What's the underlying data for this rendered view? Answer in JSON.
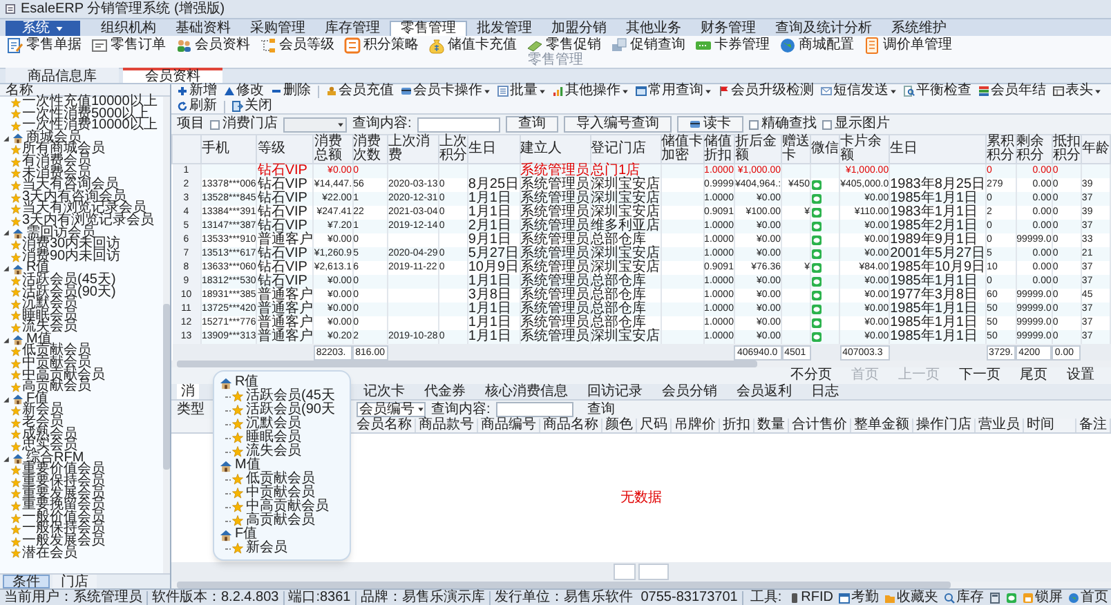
{
  "window": {
    "title": "EsaleERP 分销管理系统 (增强版)"
  },
  "menu": [
    {
      "label": "系统",
      "kind": "system",
      "selected": false
    },
    {
      "label": "组织机构",
      "kind": "tab",
      "selected": false
    },
    {
      "label": "基础资料",
      "kind": "tab",
      "selected": false
    },
    {
      "label": "采购管理",
      "kind": "tab",
      "selected": false
    },
    {
      "label": "库存管理",
      "kind": "tab",
      "selected": false
    },
    {
      "label": "零售管理",
      "kind": "tab",
      "selected": true
    },
    {
      "label": "批发管理",
      "kind": "tab",
      "selected": false
    },
    {
      "label": "加盟分销",
      "kind": "tab",
      "selected": false
    },
    {
      "label": "其他业务",
      "kind": "tab",
      "selected": false
    },
    {
      "label": "财务管理",
      "kind": "tab",
      "selected": false
    },
    {
      "label": "查询及统计分析",
      "kind": "tab",
      "selected": false
    },
    {
      "label": "系统维护",
      "kind": "tab",
      "selected": false
    }
  ],
  "ribbon": {
    "items": [
      "零售单据",
      "零售订单",
      "会员资料",
      "会员等级",
      "积分策略",
      "储值卡充值",
      "零售促销",
      "促销查询",
      "卡券管理",
      "商城配置",
      "调价单管理"
    ],
    "group_label": "零售管理"
  },
  "doc_tabs": [
    {
      "label": "商品信息库",
      "selected": false
    },
    {
      "label": "会员资料",
      "selected": true
    }
  ],
  "sidebar": {
    "header": "名称",
    "tree": [
      {
        "label": "一次性充值10000以上"
      },
      {
        "label": "一次性消费5000以上"
      },
      {
        "label": "一次性消费10000以上"
      },
      {
        "label": "商城会员",
        "expanded": true,
        "children": [
          {
            "label": "所有商城会员"
          },
          {
            "label": "有消费会员"
          },
          {
            "label": "未消费会员"
          },
          {
            "label": "当天有咨询会员"
          },
          {
            "label": "3天内有咨询会员"
          },
          {
            "label": "当天有浏览记录会员"
          },
          {
            "label": "3天内有浏览记录会员"
          }
        ]
      },
      {
        "label": "需回访会员",
        "expanded": true,
        "children": [
          {
            "label": "消费30内未回访"
          },
          {
            "label": "消费90内未回访"
          }
        ]
      },
      {
        "label": "R值",
        "expanded": true,
        "children": [
          {
            "label": "活跃会员(45天)"
          },
          {
            "label": "活跃会员(90天)"
          },
          {
            "label": "沉默会员"
          },
          {
            "label": "睡眠会员"
          },
          {
            "label": "流失会员"
          }
        ]
      },
      {
        "label": "M值",
        "expanded": true,
        "children": [
          {
            "label": "低贡献会员"
          },
          {
            "label": "中贡献会员"
          },
          {
            "label": "中高贡献会员"
          },
          {
            "label": "高贡献会员"
          }
        ]
      },
      {
        "label": "F值",
        "expanded": true,
        "children": [
          {
            "label": "新会员"
          },
          {
            "label": "老会员"
          },
          {
            "label": "成熟会员"
          },
          {
            "label": "忠实会员"
          }
        ]
      },
      {
        "label": "综合RFM",
        "expanded": true,
        "children": [
          {
            "label": "重要价值会员"
          },
          {
            "label": "重要保持会员"
          },
          {
            "label": "重要发展会员"
          },
          {
            "label": "重要挽留会员"
          },
          {
            "label": "一般价值会员"
          },
          {
            "label": "一般保持会员"
          },
          {
            "label": "一般发展会员"
          },
          {
            "label": "潜在会员"
          }
        ]
      }
    ],
    "tabs": [
      {
        "label": "条件",
        "selected": true
      },
      {
        "label": "门店",
        "selected": false
      }
    ]
  },
  "toolbar": [
    [
      {
        "label": "新增",
        "dropdown": false
      },
      {
        "label": "修改",
        "dropdown": false
      },
      {
        "label": "删除",
        "dropdown": false
      }
    ],
    [
      {
        "label": "会员充值",
        "dropdown": false
      },
      {
        "label": "会员卡操作",
        "dropdown": true
      },
      {
        "label": "批量",
        "dropdown": true
      },
      {
        "label": "其他操作",
        "dropdown": true
      },
      {
        "label": "常用查询",
        "dropdown": true
      },
      {
        "label": "会员升级检测",
        "dropdown": false
      },
      {
        "label": "短信发送",
        "dropdown": true
      },
      {
        "label": "平衡检查",
        "dropdown": false
      },
      {
        "label": "会员年结",
        "dropdown": false
      },
      {
        "label": "表头",
        "dropdown": true
      },
      {
        "label": "刷新",
        "dropdown": false
      }
    ],
    [
      {
        "label": "关闭",
        "dropdown": false
      }
    ]
  ],
  "filter": {
    "label": "项目",
    "store_checkbox": {
      "label": "消费门店",
      "checked": false
    },
    "query_label": "查询内容:",
    "buttons": [
      "查询",
      "导入编号查询",
      "读卡"
    ],
    "checkboxes": [
      {
        "label": "精确查找",
        "checked": false
      },
      {
        "label": "显示图片",
        "checked": false
      }
    ]
  },
  "table": {
    "columns": [
      {
        "kind": "text"
      },
      {
        "label": "手机",
        "kind": "text"
      },
      {
        "label": "等级",
        "kind": "text"
      },
      {
        "label": "消费总额",
        "kind": "text"
      },
      {
        "label": "消费次数",
        "kind": "text"
      },
      {
        "label": "上次消费",
        "kind": "text"
      },
      {
        "label": "上次积分",
        "kind": "text"
      },
      {
        "label": "生日",
        "kind": "text"
      },
      {
        "label": "建立人",
        "kind": "text"
      },
      {
        "label": "登记门店",
        "kind": "text"
      },
      {
        "label": "储值卡加密",
        "kind": "text"
      },
      {
        "label": "储值折扣",
        "kind": "text"
      },
      {
        "label": "折后金额",
        "kind": "text"
      },
      {
        "label": "赠送卡",
        "kind": "text"
      },
      {
        "label": "微信",
        "kind": "icon"
      },
      {
        "label": "卡片余额",
        "kind": "text"
      },
      {
        "label": "生日",
        "kind": "text"
      },
      {
        "label": "累积积分",
        "kind": "text"
      },
      {
        "label": "剩余积分",
        "kind": "text"
      },
      {
        "label": "抵扣积分",
        "kind": "text"
      },
      {
        "label": "年龄",
        "kind": "text"
      }
    ],
    "rows": [
      {
        "num": "1",
        "highlighted": true,
        "wechat": false,
        "level": "钻石VIP",
        "total": "¥0.00",
        "count": "0",
        "creator": "系统管理员",
        "store": "总门1店",
        "disc": "1.0000",
        "after": "¥1,000.00",
        "card": "¥1,000.00",
        "acc": "0",
        "remain": "0.00",
        "deduct": "0"
      },
      {
        "num": "2",
        "highlighted": false,
        "wechat": true,
        "phone": "13378***006",
        "level": "钻石VIP",
        "total": "¥14,447.",
        "count": "56",
        "last": "2020-03-13",
        "last_pts": "0",
        "bday": "8月25日",
        "creator": "系统管理员",
        "store": "深圳宝安店",
        "disc": "0.9999",
        "after": "¥404,964.:",
        "gift": "¥450",
        "card": "¥405,000.0",
        "bday_full": "1983年8月25日",
        "acc": "279",
        "remain": "0.00",
        "deduct": "0",
        "age": "39"
      },
      {
        "num": "3",
        "highlighted": false,
        "wechat": true,
        "phone": "13528***845",
        "level": "钻石VIP",
        "total": "¥22.00",
        "count": "1",
        "last": "2020-12-31",
        "last_pts": "0",
        "bday": "1月1日",
        "creator": "系统管理员",
        "store": "深圳宝安店",
        "disc": "1.0000",
        "after": "¥0.00",
        "card": "¥0.00",
        "bday_full": "1985年1月1日",
        "acc": "0",
        "remain": "0.00",
        "deduct": "0",
        "age": "37"
      },
      {
        "num": "4",
        "highlighted": false,
        "wechat": true,
        "phone": "13384***391",
        "level": "钻石VIP",
        "total": "¥247.41",
        "count": "22",
        "last": "2021-03-04",
        "last_pts": "0",
        "bday": "1月1日",
        "creator": "系统管理员",
        "store": "深圳宝安店",
        "disc": "0.9091",
        "after": "¥100.00",
        "gift": "¥",
        "card": "¥110.00",
        "bday_full": "1983年1月1日",
        "acc": "2",
        "remain": "0.00",
        "deduct": "0",
        "age": "39"
      },
      {
        "num": "5",
        "highlighted": false,
        "wechat": true,
        "phone": "13147***387",
        "level": "钻石VIP",
        "total": "¥7.20",
        "count": "1",
        "last": "2019-12-14",
        "last_pts": "0",
        "bday": "2月1日",
        "creator": "系统管理员",
        "store": "维多利亚店",
        "disc": "1.0000",
        "after": "¥0.00",
        "card": "¥0.00",
        "bday_full": "1985年2月1日",
        "acc": "0",
        "remain": "0.00",
        "deduct": "0",
        "age": "37"
      },
      {
        "num": "6",
        "highlighted": false,
        "wechat": true,
        "phone": "13533***910",
        "level": "普通客户",
        "total": "¥0.00",
        "count": "0",
        "bday": "9月1日",
        "creator": "系统管理员",
        "store": "总部仓库",
        "disc": "1.0000",
        "after": "¥0.00",
        "card": "¥0.00",
        "bday_full": "1989年9月1日",
        "acc": "0",
        "remain": "99999.0",
        "deduct": "0",
        "age": "33"
      },
      {
        "num": "7",
        "highlighted": false,
        "wechat": true,
        "phone": "13513***617",
        "level": "钻石VIP",
        "total": "¥1,260.9",
        "count": "5",
        "last": "2020-04-29",
        "last_pts": "0",
        "bday": "5月27日",
        "creator": "系统管理员",
        "store": "深圳宝安店",
        "disc": "1.0000",
        "after": "¥0.00",
        "card": "¥0.00",
        "bday_full": "2001年5月27日",
        "acc": "5",
        "remain": "0.00",
        "deduct": "0",
        "age": "21"
      },
      {
        "num": "8",
        "highlighted": false,
        "wechat": true,
        "phone": "13633***060",
        "level": "钻石VIP",
        "total": "¥2,613.1",
        "count": "6",
        "last": "2019-11-22",
        "last_pts": "0",
        "bday": "10月9日",
        "creator": "系统管理员",
        "store": "深圳宝安店",
        "disc": "0.9091",
        "after": "¥76.36",
        "gift": "¥",
        "card": "¥84.00",
        "bday_full": "1985年10月9日",
        "acc": "10",
        "remain": "0.00",
        "deduct": "0",
        "age": "37"
      },
      {
        "num": "9",
        "highlighted": false,
        "wechat": true,
        "phone": "18312***530",
        "level": "钻石VIP",
        "total": "¥0.00",
        "count": "0",
        "bday": "1月1日",
        "creator": "系统管理员",
        "store": "总部仓库",
        "disc": "1.0000",
        "after": "¥0.00",
        "card": "¥0.00",
        "bday_full": "1985年1月1日",
        "acc": "0",
        "remain": "0.00",
        "deduct": "0",
        "age": "37"
      },
      {
        "num": "10",
        "highlighted": false,
        "wechat": true,
        "phone": "18931***385",
        "level": "普通客户",
        "total": "¥0.00",
        "count": "0",
        "bday": "3月8日",
        "creator": "系统管理员",
        "store": "总部仓库",
        "disc": "1.0000",
        "after": "¥0.00",
        "card": "¥0.00",
        "bday_full": "1977年3月8日",
        "acc": "60",
        "remain": "99999.0",
        "deduct": "0",
        "age": "45"
      },
      {
        "num": "11",
        "highlighted": false,
        "wechat": true,
        "phone": "13725***420",
        "level": "普通客户",
        "total": "¥0.00",
        "count": "0",
        "bday": "1月1日",
        "creator": "系统管理员",
        "store": "总部仓库",
        "disc": "1.0000",
        "after": "¥0.00",
        "card": "¥0.00",
        "bday_full": "1985年1月1日",
        "acc": "50",
        "remain": "99999.0",
        "deduct": "0",
        "age": "37"
      },
      {
        "num": "12",
        "highlighted": false,
        "wechat": true,
        "phone": "15271***776",
        "level": "普通客户",
        "total": "¥0.00",
        "count": "0",
        "bday": "1月1日",
        "creator": "系统管理员",
        "store": "总部仓库",
        "disc": "1.0000",
        "after": "¥0.00",
        "card": "¥0.00",
        "bday_full": "1985年1月1日",
        "acc": "50",
        "remain": "99999.0",
        "deduct": "0",
        "age": "37"
      },
      {
        "num": "13",
        "highlighted": false,
        "wechat": true,
        "phone": "13909***313",
        "level": "普通客户",
        "total": "¥0.20",
        "count": "2",
        "last": "2019-10-28",
        "last_pts": "0",
        "bday": "1月1日",
        "creator": "系统管理员",
        "store": "深圳宝安店",
        "disc": "1.0000",
        "after": "¥0.00",
        "card": "¥0.00",
        "bday_full": "1985年1月1日",
        "acc": "50",
        "remain": "99999.0",
        "deduct": "0",
        "age": "37"
      }
    ],
    "totals": {
      "total": "82203.",
      "count": "816.00",
      "after": "406940.0",
      "gift": "4501",
      "card": "407003.3",
      "acc": "3729.",
      "remain": "4200",
      "deduct": "0.00"
    }
  },
  "pager": [
    {
      "label": "不分页",
      "disabled": false
    },
    {
      "label": "首页",
      "disabled": true
    },
    {
      "label": "上一页",
      "disabled": true
    },
    {
      "label": "下一页",
      "disabled": false
    },
    {
      "label": "尾页",
      "disabled": false
    },
    {
      "label": "设置",
      "disabled": false
    }
  ],
  "detail": {
    "tabs": [
      {
        "label": "消",
        "selected": true
      },
      {
        "label": "记次卡",
        "selected": false
      },
      {
        "label": "代金券",
        "selected": false
      },
      {
        "label": "核心消费信息",
        "selected": false
      },
      {
        "label": "回访记录",
        "selected": false
      },
      {
        "label": "会员分销",
        "selected": false
      },
      {
        "label": "会员返利",
        "selected": false
      },
      {
        "label": "日志",
        "selected": false
      }
    ],
    "type_label": "类型",
    "field_select": "会员编号",
    "query_label": "查询内容:",
    "button": "查询",
    "columns": [
      "会员名称",
      "商品款号",
      "商品编号",
      "商品名称",
      "颜色",
      "尺码",
      "吊牌价",
      "折扣",
      "数量",
      "合计售价",
      "整单金额",
      "操作门店",
      "营业员",
      "时间",
      "备注"
    ],
    "empty_text": "无数据"
  },
  "popup": {
    "groups": [
      {
        "label": "R值",
        "children": [
          {
            "label": "活跃会员(45天"
          },
          {
            "label": "活跃会员(90天"
          },
          {
            "label": "沉默会员"
          },
          {
            "label": "睡眠会员"
          },
          {
            "label": "流失会员"
          }
        ]
      },
      {
        "label": "M值",
        "children": [
          {
            "label": "低贡献会员"
          },
          {
            "label": "中贡献会员"
          },
          {
            "label": "中高贡献会员"
          },
          {
            "label": "高贡献会员"
          }
        ]
      },
      {
        "label": "F值",
        "children": [
          {
            "label": "新会员"
          }
        ]
      }
    ]
  },
  "status_bar": {
    "items": [
      "当前用户：系统管理员",
      "软件版本：8.2.4.803",
      "端口:8361",
      "品牌：易售乐演示库",
      "发行单位：易售乐软件",
      "0755-83173701"
    ],
    "tools_label": "工具:",
    "tools": [
      {
        "kind": "rfid",
        "label": "RFID"
      },
      {
        "kind": "attendance",
        "label": "考勤"
      },
      {
        "kind": "favorites",
        "label": "收藏夹"
      },
      {
        "kind": "inventory",
        "label": "库存"
      },
      {
        "kind": "calculator"
      },
      {
        "kind": "chat"
      },
      {
        "kind": "lock",
        "label": "锁屏"
      },
      {
        "kind": "home",
        "label": "首页"
      }
    ]
  }
}
